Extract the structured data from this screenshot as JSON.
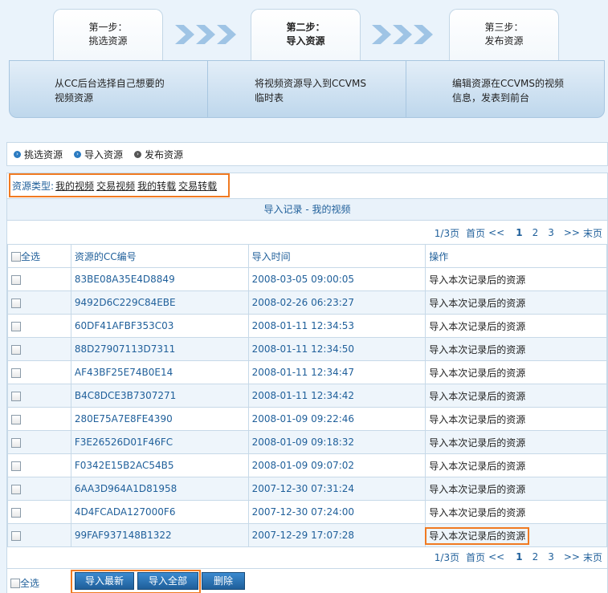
{
  "steps": [
    {
      "line1": "第一步：",
      "line2": "挑选资源",
      "active": false
    },
    {
      "line1": "第二步：",
      "line2": "导入资源",
      "active": true
    },
    {
      "line1": "第三步：",
      "line2": "发布资源",
      "active": false
    }
  ],
  "step_descriptions": [
    {
      "line1": "从CC后台选择自己想要的",
      "line2": "视频资源"
    },
    {
      "line1": "将视频资源导入到CCVMS",
      "line2": "临时表"
    },
    {
      "line1": "编辑资源在CCVMS的视频",
      "line2": "信息，发表到前台"
    }
  ],
  "nav": [
    {
      "label": "挑选资源",
      "icon": "blue-arrow-bullet-icon"
    },
    {
      "label": "导入资源",
      "icon": "blue-arrow-bullet-icon"
    },
    {
      "label": "发布资源",
      "icon": "gray-arrow-bullet-icon"
    }
  ],
  "filter": {
    "label": "资源类型:",
    "options": [
      "我的视频",
      "交易视频",
      "我的转载",
      "交易转载"
    ]
  },
  "record_title": "导入记录 - 我的视频",
  "pager": {
    "page_info": "1/3页",
    "first": "首页",
    "prev": "<<",
    "pages": [
      "1",
      "2",
      "3"
    ],
    "current": "1",
    "next": ">>",
    "last": "末页"
  },
  "table": {
    "headers": {
      "select_all": "全选",
      "code": "资源的CC编号",
      "time": "导入时间",
      "op": "操作"
    },
    "rows": [
      {
        "code": "83BE08A35E4D8849",
        "time": "2008-03-05 09:00:05",
        "op": "导入本次记录后的资源"
      },
      {
        "code": "9492D6C229C84EBE",
        "time": "2008-02-26 06:23:27",
        "op": "导入本次记录后的资源"
      },
      {
        "code": "60DF41AFBF353C03",
        "time": "2008-01-11 12:34:53",
        "op": "导入本次记录后的资源"
      },
      {
        "code": "88D27907113D7311",
        "time": "2008-01-11 12:34:50",
        "op": "导入本次记录后的资源"
      },
      {
        "code": "AF43BF25E74B0E14",
        "time": "2008-01-11 12:34:47",
        "op": "导入本次记录后的资源"
      },
      {
        "code": "B4C8DCE3B7307271",
        "time": "2008-01-11 12:34:42",
        "op": "导入本次记录后的资源"
      },
      {
        "code": "280E75A7E8FE4390",
        "time": "2008-01-09 09:22:46",
        "op": "导入本次记录后的资源"
      },
      {
        "code": "F3E26526D01F46FC",
        "time": "2008-01-09 09:18:32",
        "op": "导入本次记录后的资源"
      },
      {
        "code": "F0342E15B2AC54B5",
        "time": "2008-01-09 09:07:02",
        "op": "导入本次记录后的资源"
      },
      {
        "code": "6AA3D964A1D81958",
        "time": "2007-12-30 07:31:24",
        "op": "导入本次记录后的资源"
      },
      {
        "code": "4D4FCADA127000F6",
        "time": "2007-12-30 07:24:00",
        "op": "导入本次记录后的资源"
      },
      {
        "code": "99FAF937148B1322",
        "time": "2007-12-29 17:07:28",
        "op": "导入本次记录后的资源"
      }
    ]
  },
  "bottom": {
    "select_all": "全选",
    "import_new": "导入最新",
    "import_all": "导入全部",
    "delete": "删除"
  },
  "colors": {
    "accent": "#1f5f9a",
    "highlight": "#f07a22",
    "arrow": "#9fc4e5"
  }
}
